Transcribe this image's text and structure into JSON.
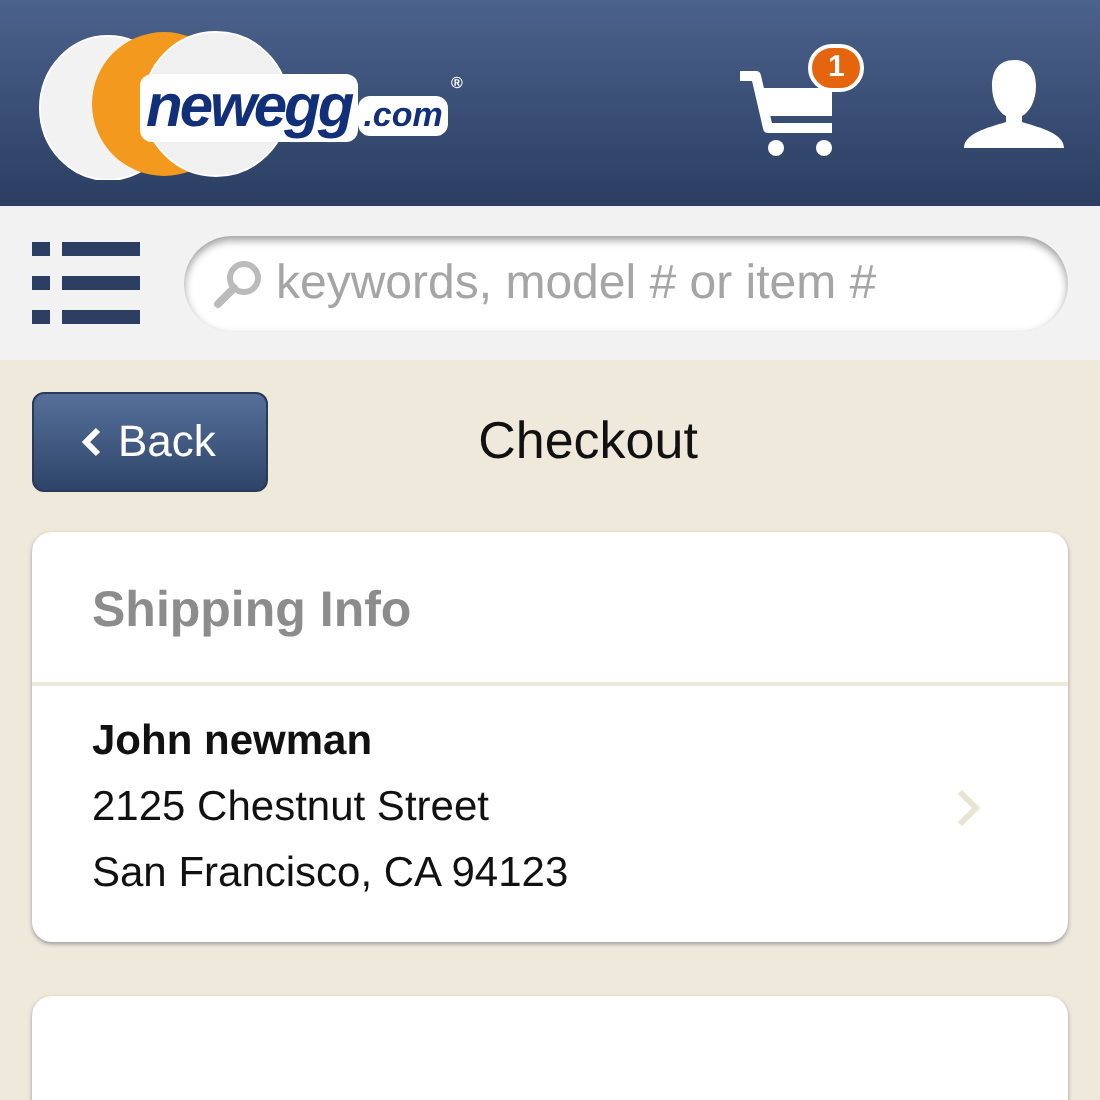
{
  "header": {
    "logo": {
      "name": "newegg",
      "suffix": ".com",
      "mark": "®"
    },
    "cart_count": "1"
  },
  "search": {
    "placeholder": "keywords, model # or item #"
  },
  "nav": {
    "back": "Back",
    "title": "Checkout"
  },
  "cards": [
    {
      "title": "Shipping Info",
      "lines": [
        {
          "text": "John newman",
          "bold": true
        },
        {
          "text": "2125 Chestnut Street",
          "bold": false
        },
        {
          "text": "San Francisco, CA 94123",
          "bold": false
        }
      ]
    }
  ],
  "next_card": {
    "kind": "partial"
  }
}
